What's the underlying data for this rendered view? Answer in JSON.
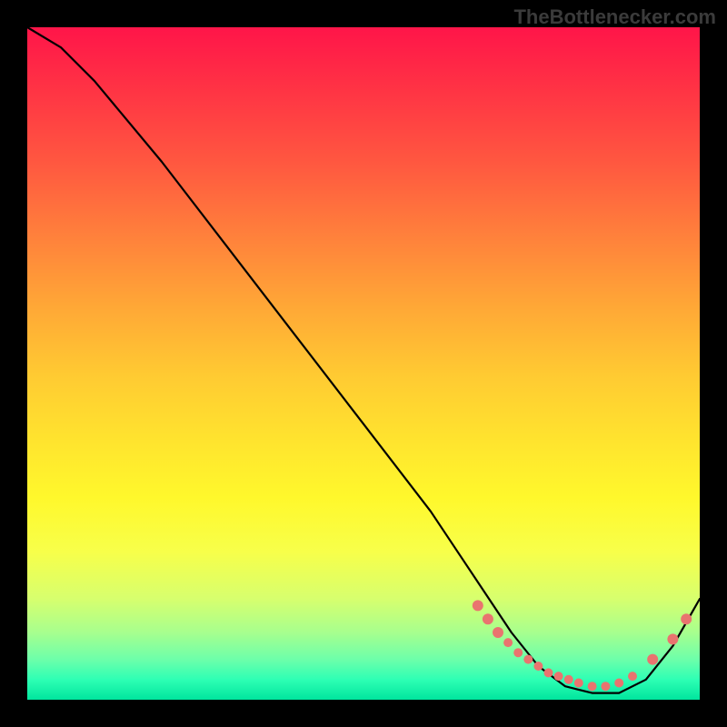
{
  "attribution": "TheBottlenecker.com",
  "chart_data": {
    "type": "line",
    "title": "",
    "xlabel": "",
    "ylabel": "",
    "xlim": [
      0,
      100
    ],
    "ylim": [
      0,
      100
    ],
    "grid": false,
    "series": [
      {
        "name": "curve",
        "x": [
          0,
          5,
          10,
          20,
          30,
          40,
          50,
          60,
          68,
          72,
          76,
          80,
          84,
          88,
          92,
          96,
          100
        ],
        "y": [
          100,
          97,
          92,
          80,
          67,
          54,
          41,
          28,
          16,
          10,
          5,
          2,
          1,
          1,
          3,
          8,
          15
        ]
      }
    ],
    "markers": {
      "comment": "salmon dots along the low valley and rising tail",
      "x": [
        67,
        68.5,
        70,
        71.5,
        73,
        74.5,
        76,
        77.5,
        79,
        80.5,
        82,
        84,
        86,
        88,
        90,
        93,
        96,
        98
      ],
      "y": [
        14,
        12,
        10,
        8.5,
        7,
        6,
        5,
        4,
        3.5,
        3,
        2.5,
        2,
        2,
        2.5,
        3.5,
        6,
        9,
        12
      ]
    },
    "colors": {
      "curve": "#000000",
      "marker": "#e9746f"
    }
  }
}
